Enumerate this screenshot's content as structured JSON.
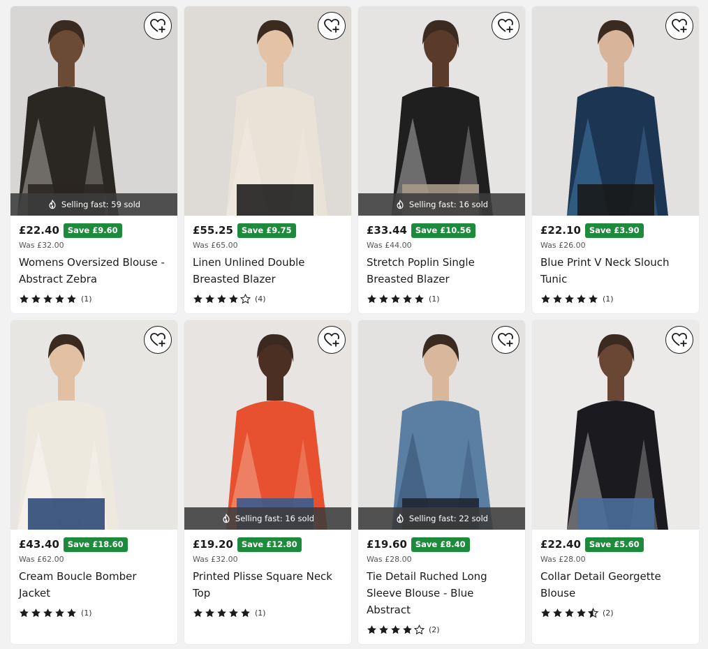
{
  "products": [
    {
      "price": "£22.40",
      "save": "Save £9.60",
      "was": "Was £32.00",
      "title": "Womens Oversized Blouse - Abstract Zebra",
      "rating": 5,
      "count": "(1)",
      "selling": "Selling fast: 59 sold",
      "colors": {
        "bg": "#d8d6d4",
        "garment": "#2a2622",
        "accent": "#f1ede6",
        "skin": "#6b4a36",
        "lower": "#2a2622"
      }
    },
    {
      "price": "£55.25",
      "save": "Save £9.75",
      "was": "Was £65.00",
      "title": "Linen Unlined Double Breasted Blazer",
      "rating": 4,
      "count": "(4)",
      "selling": "",
      "colors": {
        "bg": "#dedbd7",
        "garment": "#e9e2d6",
        "accent": "#f5f1ea",
        "skin": "#e3c2a6",
        "lower": "#1f1f1f"
      }
    },
    {
      "price": "£33.44",
      "save": "Save £10.56",
      "was": "Was £44.00",
      "title": "Stretch Poplin Single Breasted Blazer",
      "rating": 5,
      "count": "(1)",
      "selling": "Selling fast: 16 sold",
      "colors": {
        "bg": "#e6e4e2",
        "garment": "#1f1f1f",
        "accent": "#ffffff",
        "skin": "#5a3a28",
        "lower": "#a59987"
      }
    },
    {
      "price": "£22.10",
      "save": "Save £3.90",
      "was": "Was £26.00",
      "title": "Blue Print V Neck Slouch Tunic",
      "rating": 5,
      "count": "(1)",
      "selling": "",
      "colors": {
        "bg": "#e3e1df",
        "garment": "#1c3552",
        "accent": "#5aa0d8",
        "skin": "#d8b49b",
        "lower": "#1a1a1a"
      }
    },
    {
      "price": "£43.40",
      "save": "Save £18.60",
      "was": "Was £62.00",
      "title": "Cream Boucle Bomber Jacket",
      "rating": 5,
      "count": "(1)",
      "selling": "",
      "colors": {
        "bg": "#e8e6e3",
        "garment": "#eee9de",
        "accent": "#ffffff",
        "skin": "#e2c0a4",
        "lower": "#2e4a78"
      }
    },
    {
      "price": "£19.20",
      "save": "Save £12.80",
      "was": "Was £32.00",
      "title": "Printed Plisse Square Neck Top",
      "rating": 5,
      "count": "(1)",
      "selling": "Selling fast: 16 sold",
      "colors": {
        "bg": "#e7e4e1",
        "garment": "#e8512f",
        "accent": "#f7d6c6",
        "skin": "#4a2f22",
        "lower": "#3a5a8c"
      }
    },
    {
      "price": "£19.60",
      "save": "Save £8.40",
      "was": "Was £28.00",
      "title": "Tie Detail Ruched Long Sleeve Blouse - Blue Abstract",
      "rating": 4,
      "count": "(2)",
      "selling": "Selling fast: 22 sold",
      "colors": {
        "bg": "#e4e2e0",
        "garment": "#5a7fa3",
        "accent": "#1f3550",
        "skin": "#d9b79d",
        "lower": "#1d2733"
      }
    },
    {
      "price": "£22.40",
      "save": "Save £5.60",
      "was": "Was £28.00",
      "title": "Collar Detail Georgette Blouse",
      "rating": 4.5,
      "count": "(2)",
      "selling": "",
      "colors": {
        "bg": "#eceae8",
        "garment": "#1b1b1f",
        "accent": "#ffffff",
        "skin": "#6a4634",
        "lower": "#4a6d9a"
      }
    }
  ],
  "icons": {
    "wishlist": "heart-plus-icon",
    "selling": "flame-icon",
    "star": "star-icon"
  }
}
